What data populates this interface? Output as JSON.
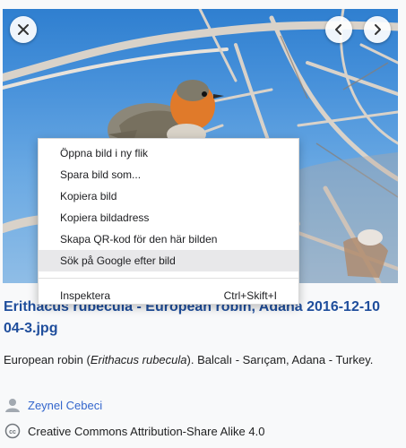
{
  "context_menu": {
    "items": [
      {
        "label": "Öppna bild i ny flik"
      },
      {
        "label": "Spara bild som..."
      },
      {
        "label": "Kopiera bild"
      },
      {
        "label": "Kopiera bildadress"
      },
      {
        "label": "Skapa QR-kod för den här bilden"
      },
      {
        "label": "Sök på Google efter bild"
      }
    ],
    "inspect": {
      "label": "Inspektera",
      "shortcut": "Ctrl+Skift+I"
    }
  },
  "file": {
    "title": "Erithacus rubecula - European robin, Adana 2016-12-10 04-3.jpg",
    "description_prefix": "European robin (",
    "description_species": "Erithacus rubecula",
    "description_suffix": "). Balcalı - Sarıçam, Adana - Turkey.",
    "author": "Zeynel Cebeci",
    "license": "Creative Commons Attribution-Share Alike 4.0"
  },
  "colors": {
    "title": "#1f4e9c",
    "link": "#3366cc",
    "menu_highlight": "#e8e8ea",
    "sky": "#4a93db",
    "robin_breast": "#e07a2a"
  },
  "icons": {
    "close": "close-icon",
    "previous": "chevron-left-icon",
    "next": "chevron-right-icon",
    "author": "user-icon",
    "license": "creative-commons-icon"
  }
}
